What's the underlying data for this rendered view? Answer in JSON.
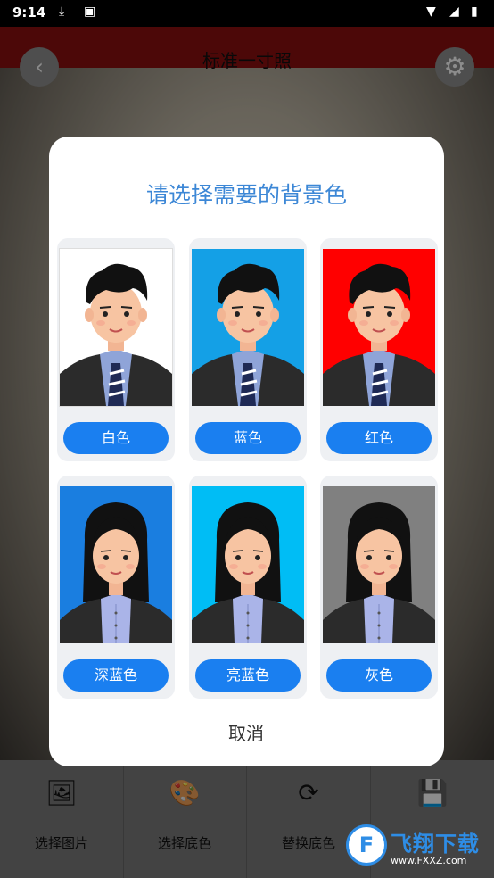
{
  "status_bar": {
    "time": "9:14"
  },
  "app": {
    "title": "标准一寸照"
  },
  "dialog": {
    "title": "请选择需要的背景色",
    "cancel_label": "取消",
    "options": [
      {
        "label": "白色",
        "bg": "#ffffff",
        "figure": "male"
      },
      {
        "label": "蓝色",
        "bg": "#14a0e6",
        "figure": "male"
      },
      {
        "label": "红色",
        "bg": "#ff0000",
        "figure": "male"
      },
      {
        "label": "深蓝色",
        "bg": "#1a7ee0",
        "figure": "female"
      },
      {
        "label": "亮蓝色",
        "bg": "#00bdf5",
        "figure": "female"
      },
      {
        "label": "灰色",
        "bg": "#808080",
        "figure": "female"
      }
    ]
  },
  "toolbar": {
    "items": [
      {
        "label": "选择图片",
        "icon": "image-icon"
      },
      {
        "label": "选择底色",
        "icon": "palette-icon"
      },
      {
        "label": "替换底色",
        "icon": "swap-icon"
      },
      {
        "label": "",
        "icon": "save-icon"
      }
    ]
  },
  "watermark": {
    "text": "飞翔下载",
    "url": "www.FXXZ.com"
  },
  "colors": {
    "accent": "#1a7ff0",
    "dialog_title": "#3c87d6",
    "topbar": "#8a1010"
  }
}
